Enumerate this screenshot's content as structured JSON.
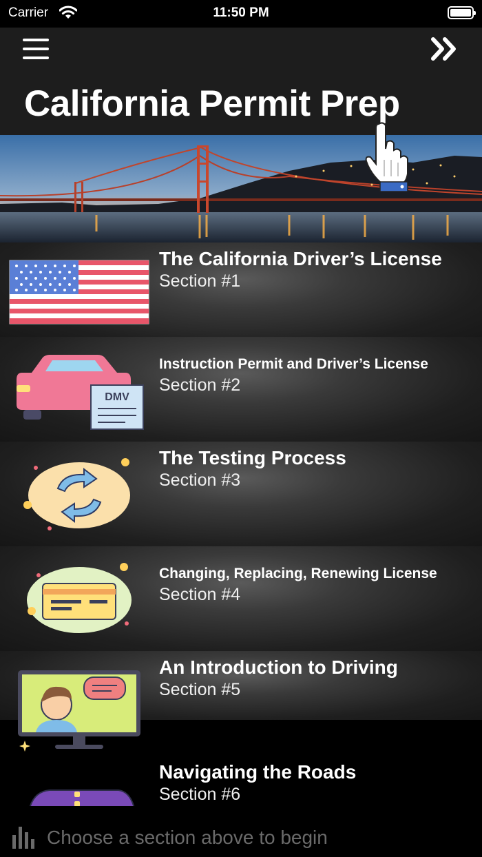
{
  "status_bar": {
    "carrier": "Carrier",
    "time": "11:50 PM"
  },
  "header": {
    "title": "California Permit Prep"
  },
  "sections": [
    {
      "title": "The California Driver’s License",
      "subtitle": "Section #1",
      "icon": "us-flag-icon"
    },
    {
      "title": "Instruction Permit and Driver’s License",
      "subtitle": "Section #2",
      "icon": "car-dmv-icon"
    },
    {
      "title": "The Testing Process",
      "subtitle": "Section #3",
      "icon": "refresh-cycle-icon"
    },
    {
      "title": "Changing, Replacing, Renewing License",
      "subtitle": "Section #4",
      "icon": "license-card-icon"
    },
    {
      "title": "An Introduction to Driving",
      "subtitle": "Section #5",
      "icon": "video-call-icon"
    },
    {
      "title": "Navigating the Roads",
      "subtitle": "Section #6",
      "icon": "vehicle-icon"
    }
  ],
  "footer": {
    "prompt": "Choose a section above to begin"
  },
  "colors": {
    "background": "#000000",
    "nav": "#1d1d1d",
    "footer_text": "#6a6a6a"
  }
}
